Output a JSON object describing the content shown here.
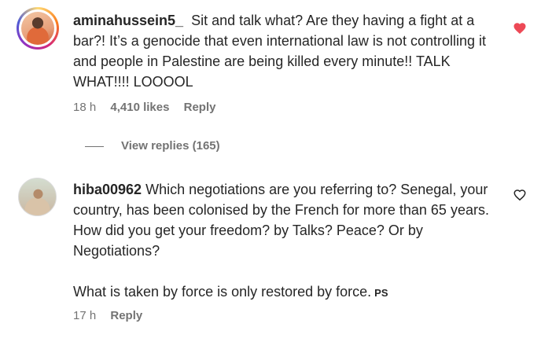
{
  "comments": [
    {
      "username": "aminahussein5_",
      "text": "Sit and talk what? Are they having a fight at a bar?! It’s a genocide that even international law is not controlling it and people in Palestine are being killed every minute!! TALK WHAT!!!! LOOOOL",
      "time": "18 h",
      "likes": "4,410 likes",
      "reply": "Reply",
      "view_replies": "View replies (165)",
      "liked": true,
      "like_icon": "heart-filled-icon",
      "like_color": "#ed4956"
    },
    {
      "username": "hiba00962",
      "text_p1": "Which negotiations are you referring to? Senegal, your country, has been colonised by the French for more than 65 years. How did you get your freedom? by Talks? Peace? Or by Negotiations?",
      "text_p2": "What is taken by force is only restored by force.",
      "tag": "PS",
      "time": "17 h",
      "reply": "Reply",
      "liked": false,
      "like_icon": "heart-outline-icon"
    }
  ]
}
